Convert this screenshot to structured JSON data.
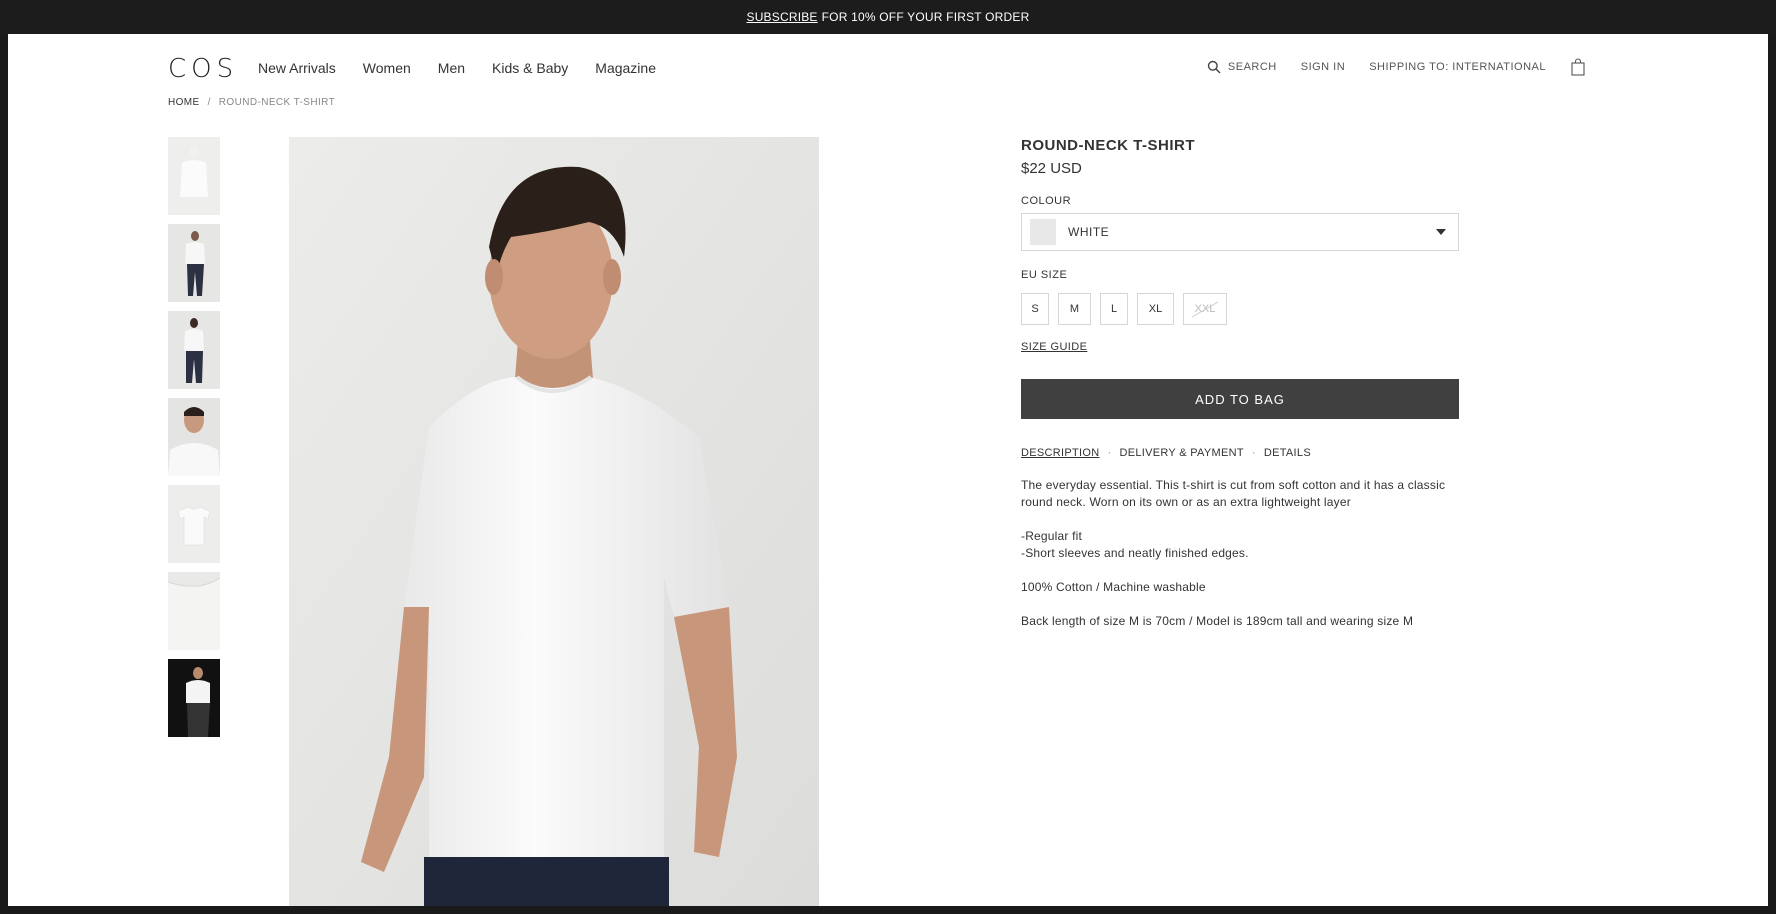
{
  "promo": {
    "link": "SUBSCRIBE",
    "text": "FOR 10% OFF YOUR FIRST ORDER"
  },
  "header": {
    "logo": "COS",
    "nav": [
      "New Arrivals",
      "Women",
      "Men",
      "Kids & Baby",
      "Magazine"
    ],
    "search": "SEARCH",
    "sign_in": "SIGN IN",
    "shipping": "SHIPPING TO: INTERNATIONAL",
    "bag_icon": "shopping-bag-icon",
    "search_icon": "magnifier-icon"
  },
  "breadcrumb": {
    "home": "HOME",
    "sep": "/",
    "current": "ROUND-NECK T-SHIRT"
  },
  "product": {
    "title": "ROUND-NECK T-SHIRT",
    "price": "$22 USD",
    "colour_label": "COLOUR",
    "colour_value": "WHITE",
    "colour_swatch": "#e8e8e8",
    "size_label": "EU SIZE",
    "sizes": [
      {
        "label": "S",
        "available": true
      },
      {
        "label": "M",
        "available": true
      },
      {
        "label": "L",
        "available": true
      },
      {
        "label": "XL",
        "available": true
      },
      {
        "label": "XXL",
        "available": false
      }
    ],
    "size_guide": "SIZE GUIDE",
    "add_to_bag": "ADD TO BAG",
    "tabs": [
      "DESCRIPTION",
      "DELIVERY & PAYMENT",
      "DETAILS"
    ],
    "tab_sep": "·",
    "description": [
      "The everyday essential. This t-shirt is cut from soft cotton and it has a classic round neck. Worn on its own or as an extra lightweight layer",
      "-Regular fit\n-Short sleeves and neatly finished edges.",
      "100% Cotton / Machine washable",
      "Back length of size M is 70cm / Model is 189cm tall and wearing size M"
    ]
  },
  "colors": {
    "button": "#404040",
    "promo_bg": "#1c1c1c",
    "accent_dark": "#222222"
  }
}
